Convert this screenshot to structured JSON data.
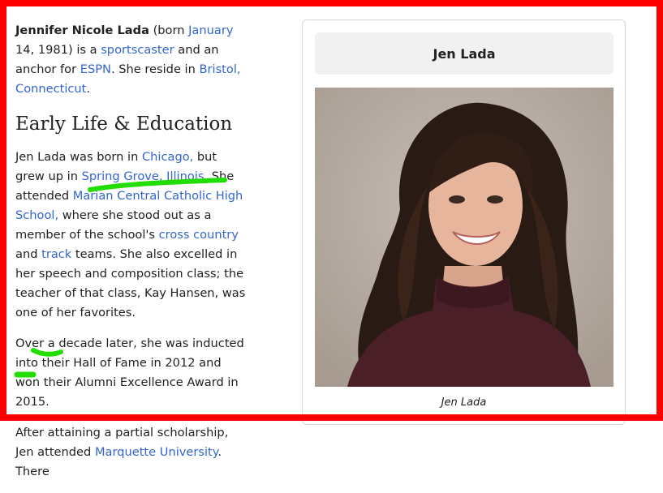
{
  "article": {
    "intro": {
      "name": "Jennifer Nicole Lada",
      "t1": " (born ",
      "link_date": "January",
      "t2": " 14, 1981) is a ",
      "link_job": "sportscaster",
      "t3": " and an anchor for ",
      "link_espn": "ESPN",
      "t4": ". She reside in ",
      "link_city": "Bristol, Connecticut",
      "t5": "."
    },
    "heading": "Early Life & Education",
    "p1": {
      "t1": "Jen Lada was born in ",
      "link_chicago": "Chicago,",
      "t2": " but grew up in ",
      "link_springgrove": "Spring Grove, Illinois",
      "t3": ". She attended ",
      "link_school": "Marian Central Catholic High School,",
      "t4": " where she stood out as a member of the school's ",
      "link_xc": "cross country",
      "t5": " and ",
      "link_track": "track",
      "t6": " teams. She also excelled in her speech and composition class; the teacher of that class, Kay Hansen, was one of her favorites."
    },
    "p2": "Over a decade later, she was inducted into their Hall of Fame in 2012 and won their Alumni Excellence Award in 2015.",
    "p3": {
      "t1": "After attaining a partial scholarship, Jen attended ",
      "link_marquette": "Marquette University",
      "t2": ". There"
    }
  },
  "infobox": {
    "title": "Jen Lada",
    "caption": "Jen Lada"
  },
  "colors": {
    "frame": "#ff0000",
    "link": "#3366cc",
    "highlighter": "#22dd00"
  }
}
